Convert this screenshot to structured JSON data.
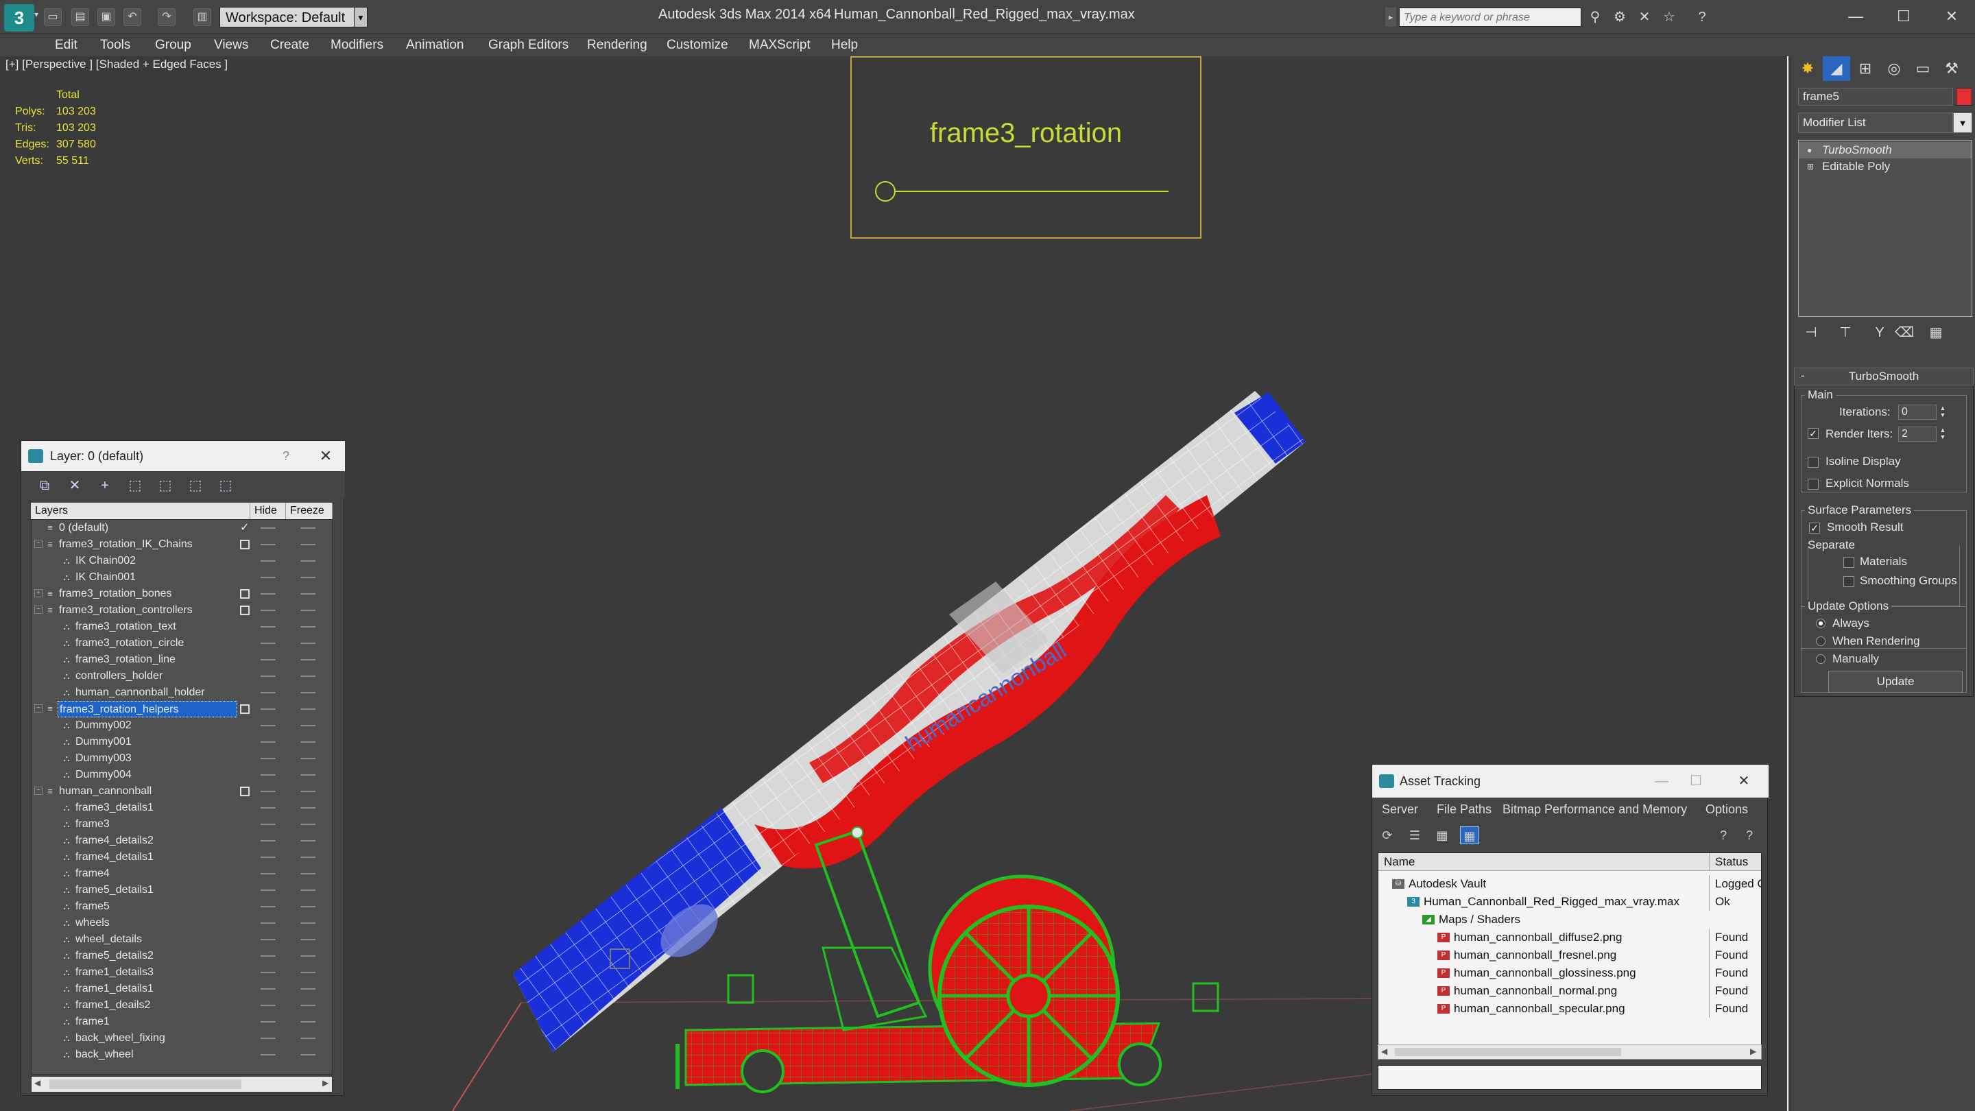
{
  "window": {
    "app_title": "Autodesk 3ds Max  2014 x64",
    "file_title": "Human_Cannonball_Red_Rigged_max_vray.max",
    "workspace": "Workspace: Default",
    "search_placeholder": "Type a keyword or phrase"
  },
  "menubar": [
    "Edit",
    "Tools",
    "Group",
    "Views",
    "Create",
    "Modifiers",
    "Animation",
    "Graph Editors",
    "Rendering",
    "Customize",
    "MAXScript",
    "Help"
  ],
  "viewport": {
    "label": "[+] [Perspective ] [Shaded + Edged Faces ]",
    "stats": {
      "header": "Total",
      "rows": [
        {
          "label": "Polys:",
          "value": "103 203"
        },
        {
          "label": "Tris:",
          "value": "103 203"
        },
        {
          "label": "Edges:",
          "value": "307 580"
        },
        {
          "label": "Verts:",
          "value": "55 511"
        }
      ]
    },
    "rotation_label": "frame3_rotation",
    "cannon_text": "humancannonball"
  },
  "layer_panel": {
    "title": "Layer: 0 (default)",
    "help": "?",
    "columns": [
      "Layers",
      "Hide",
      "Freeze"
    ],
    "rows": [
      {
        "name": "0 (default)",
        "level": 0,
        "type": "layer",
        "expander": "",
        "mark": "check"
      },
      {
        "name": "frame3_rotation_IK_Chains",
        "level": 0,
        "type": "layer",
        "expander": "−",
        "mark": "box"
      },
      {
        "name": "IK Chain002",
        "level": 1,
        "type": "object",
        "expander": "",
        "mark": ""
      },
      {
        "name": "IK Chain001",
        "level": 1,
        "type": "object",
        "expander": "",
        "mark": ""
      },
      {
        "name": "frame3_rotation_bones",
        "level": 0,
        "type": "layer",
        "expander": "+",
        "mark": "box"
      },
      {
        "name": "frame3_rotation_controllers",
        "level": 0,
        "type": "layer",
        "expander": "−",
        "mark": "box"
      },
      {
        "name": "frame3_rotation_text",
        "level": 1,
        "type": "object",
        "expander": "",
        "mark": ""
      },
      {
        "name": "frame3_rotation_circle",
        "level": 1,
        "type": "object",
        "expander": "",
        "mark": ""
      },
      {
        "name": "frame3_rotation_line",
        "level": 1,
        "type": "object",
        "expander": "",
        "mark": ""
      },
      {
        "name": "controllers_holder",
        "level": 1,
        "type": "object",
        "expander": "",
        "mark": ""
      },
      {
        "name": "human_cannonball_holder",
        "level": 1,
        "type": "object",
        "expander": "",
        "mark": ""
      },
      {
        "name": "frame3_rotation_helpers",
        "level": 0,
        "type": "layer",
        "expander": "−",
        "mark": "box",
        "selected": true
      },
      {
        "name": "Dummy002",
        "level": 1,
        "type": "object",
        "expander": "",
        "mark": ""
      },
      {
        "name": "Dummy001",
        "level": 1,
        "type": "object",
        "expander": "",
        "mark": ""
      },
      {
        "name": "Dummy003",
        "level": 1,
        "type": "object",
        "expander": "",
        "mark": ""
      },
      {
        "name": "Dummy004",
        "level": 1,
        "type": "object",
        "expander": "",
        "mark": ""
      },
      {
        "name": "human_cannonball",
        "level": 0,
        "type": "layer",
        "expander": "−",
        "mark": "box"
      },
      {
        "name": "frame3_details1",
        "level": 1,
        "type": "object",
        "expander": "",
        "mark": ""
      },
      {
        "name": "frame3",
        "level": 1,
        "type": "object",
        "expander": "",
        "mark": ""
      },
      {
        "name": "frame4_details2",
        "level": 1,
        "type": "object",
        "expander": "",
        "mark": ""
      },
      {
        "name": "frame4_details1",
        "level": 1,
        "type": "object",
        "expander": "",
        "mark": ""
      },
      {
        "name": "frame4",
        "level": 1,
        "type": "object",
        "expander": "",
        "mark": ""
      },
      {
        "name": "frame5_details1",
        "level": 1,
        "type": "object",
        "expander": "",
        "mark": ""
      },
      {
        "name": "frame5",
        "level": 1,
        "type": "object",
        "expander": "",
        "mark": ""
      },
      {
        "name": "wheels",
        "level": 1,
        "type": "object",
        "expander": "",
        "mark": ""
      },
      {
        "name": "wheel_details",
        "level": 1,
        "type": "object",
        "expander": "",
        "mark": ""
      },
      {
        "name": "frame5_details2",
        "level": 1,
        "type": "object",
        "expander": "",
        "mark": ""
      },
      {
        "name": "frame1_details3",
        "level": 1,
        "type": "object",
        "expander": "",
        "mark": ""
      },
      {
        "name": "frame1_details1",
        "level": 1,
        "type": "object",
        "expander": "",
        "mark": ""
      },
      {
        "name": "frame1_deails2",
        "level": 1,
        "type": "object",
        "expander": "",
        "mark": ""
      },
      {
        "name": "frame1",
        "level": 1,
        "type": "object",
        "expander": "",
        "mark": ""
      },
      {
        "name": "back_wheel_fixing",
        "level": 1,
        "type": "object",
        "expander": "",
        "mark": ""
      },
      {
        "name": "back_wheel",
        "level": 1,
        "type": "object",
        "expander": "",
        "mark": ""
      }
    ]
  },
  "asset_panel": {
    "title": "Asset Tracking",
    "menu": [
      "Server",
      "File",
      "Paths",
      "Bitmap Performance and Memory",
      "Options"
    ],
    "columns": [
      "Name",
      "Status"
    ],
    "rows": [
      {
        "name": "Autodesk Vault",
        "status": "Logged O",
        "indent": 0,
        "icon": "vault"
      },
      {
        "name": "Human_Cannonball_Red_Rigged_max_vray.max",
        "status": "Ok",
        "indent": 1,
        "icon": "max"
      },
      {
        "name": "Maps / Shaders",
        "status": "",
        "indent": 2,
        "icon": "maps"
      },
      {
        "name": "human_cannonball_diffuse2.png",
        "status": "Found",
        "indent": 3,
        "icon": "png"
      },
      {
        "name": "human_cannonball_fresnel.png",
        "status": "Found",
        "indent": 3,
        "icon": "png"
      },
      {
        "name": "human_cannonball_glossiness.png",
        "status": "Found",
        "indent": 3,
        "icon": "png"
      },
      {
        "name": "human_cannonball_normal.png",
        "status": "Found",
        "indent": 3,
        "icon": "png"
      },
      {
        "name": "human_cannonball_specular.png",
        "status": "Found",
        "indent": 3,
        "icon": "png"
      }
    ]
  },
  "command_panel": {
    "object_name": "frame5",
    "modifier_list": "Modifier List",
    "stack": [
      "TurboSmooth",
      "Editable Poly"
    ],
    "rollout_title": "TurboSmooth",
    "main_group": "Main",
    "iterations_label": "Iterations:",
    "iterations_value": "0",
    "render_iters_label": "Render Iters:",
    "render_iters_value": "2",
    "render_iters_checked": true,
    "isoline_label": "Isoline Display",
    "explicit_normals_label": "Explicit Normals",
    "surface_group": "Surface Parameters",
    "smooth_result_label": "Smooth Result",
    "separate_label": "Separate",
    "materials_label": "Materials",
    "smoothing_groups_label": "Smoothing Groups",
    "update_group": "Update Options",
    "always_label": "Always",
    "when_rendering_label": "When Rendering",
    "manually_label": "Manually",
    "update_button": "Update"
  },
  "colors": {
    "cannon_red": "#e01414",
    "cannon_blue": "#1a2fd8",
    "frame_green": "#20c020",
    "text_yellow": "#e8e43c",
    "selection_blue": "#1e64c8"
  }
}
